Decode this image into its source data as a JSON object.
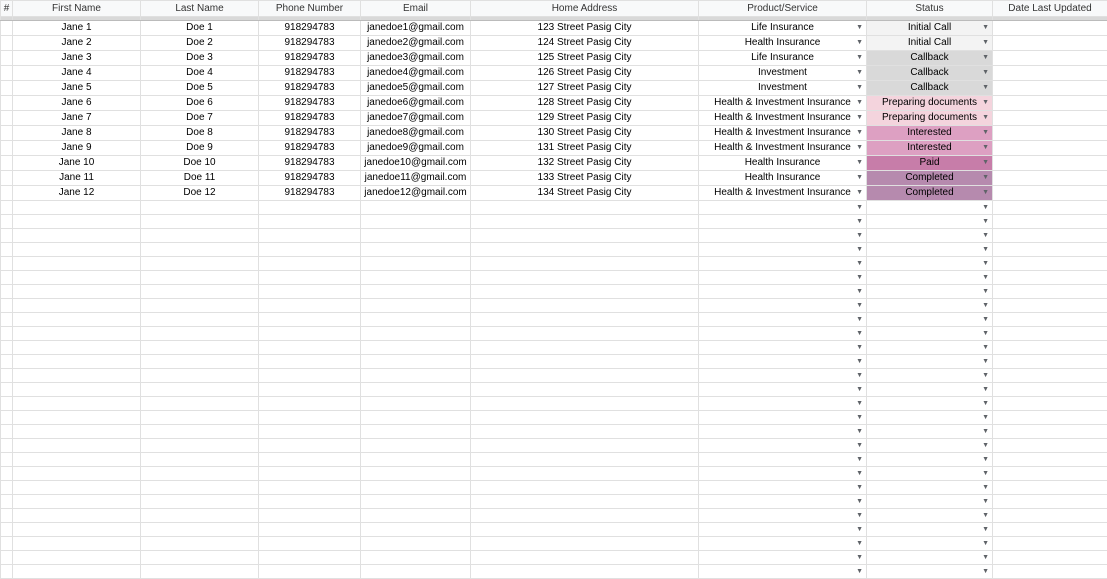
{
  "headers": {
    "num": "#",
    "first": "First Name",
    "last": "Last Name",
    "phone": "Phone Number",
    "email": "Email",
    "addr": "Home Address",
    "prod": "Product/Service",
    "status": "Status",
    "date": "Date Last Updated"
  },
  "statusColors": {
    "Initial Call": "#f3f3f3",
    "Callback": "#d9d9d9",
    "Preparing documents": "#f4d4dd",
    "Interested": "#dda0c2",
    "Paid": "#c77da9",
    "Completed": "#b68aae"
  },
  "rows": [
    {
      "first": "Jane 1",
      "last": "Doe 1",
      "phone": "918294783",
      "email": "janedoe1@gmail.com",
      "addr": "123 Street Pasig City",
      "prod": "Life Insurance",
      "status": "Initial Call"
    },
    {
      "first": "Jane 2",
      "last": "Doe 2",
      "phone": "918294783",
      "email": "janedoe2@gmail.com",
      "addr": "124 Street Pasig City",
      "prod": "Health Insurance",
      "status": "Initial Call"
    },
    {
      "first": "Jane 3",
      "last": "Doe 3",
      "phone": "918294783",
      "email": "janedoe3@gmail.com",
      "addr": "125 Street Pasig City",
      "prod": "Life Insurance",
      "status": "Callback"
    },
    {
      "first": "Jane 4",
      "last": "Doe 4",
      "phone": "918294783",
      "email": "janedoe4@gmail.com",
      "addr": "126 Street Pasig City",
      "prod": "Investment",
      "status": "Callback"
    },
    {
      "first": "Jane 5",
      "last": "Doe 5",
      "phone": "918294783",
      "email": "janedoe5@gmail.com",
      "addr": "127 Street Pasig City",
      "prod": "Investment",
      "status": "Callback"
    },
    {
      "first": "Jane 6",
      "last": "Doe 6",
      "phone": "918294783",
      "email": "janedoe6@gmail.com",
      "addr": "128 Street Pasig City",
      "prod": "Health & Investment Insurance",
      "status": "Preparing documents"
    },
    {
      "first": "Jane 7",
      "last": "Doe 7",
      "phone": "918294783",
      "email": "janedoe7@gmail.com",
      "addr": "129 Street Pasig City",
      "prod": "Health & Investment Insurance",
      "status": "Preparing documents"
    },
    {
      "first": "Jane 8",
      "last": "Doe 8",
      "phone": "918294783",
      "email": "janedoe8@gmail.com",
      "addr": "130 Street Pasig City",
      "prod": "Health & Investment Insurance",
      "status": "Interested"
    },
    {
      "first": "Jane 9",
      "last": "Doe 9",
      "phone": "918294783",
      "email": "janedoe9@gmail.com",
      "addr": "131 Street Pasig City",
      "prod": "Health & Investment Insurance",
      "status": "Interested"
    },
    {
      "first": "Jane 10",
      "last": "Doe 10",
      "phone": "918294783",
      "email": "janedoe10@gmail.com",
      "addr": "132 Street Pasig City",
      "prod": "Health Insurance",
      "status": "Paid"
    },
    {
      "first": "Jane 11",
      "last": "Doe 11",
      "phone": "918294783",
      "email": "janedoe11@gmail.com",
      "addr": "133 Street Pasig City",
      "prod": "Health Insurance",
      "status": "Completed"
    },
    {
      "first": "Jane 12",
      "last": "Doe 12",
      "phone": "918294783",
      "email": "janedoe12@gmail.com",
      "addr": "134 Street Pasig City",
      "prod": "Health & Investment Insurance",
      "status": "Completed"
    }
  ],
  "emptyRows": 27
}
